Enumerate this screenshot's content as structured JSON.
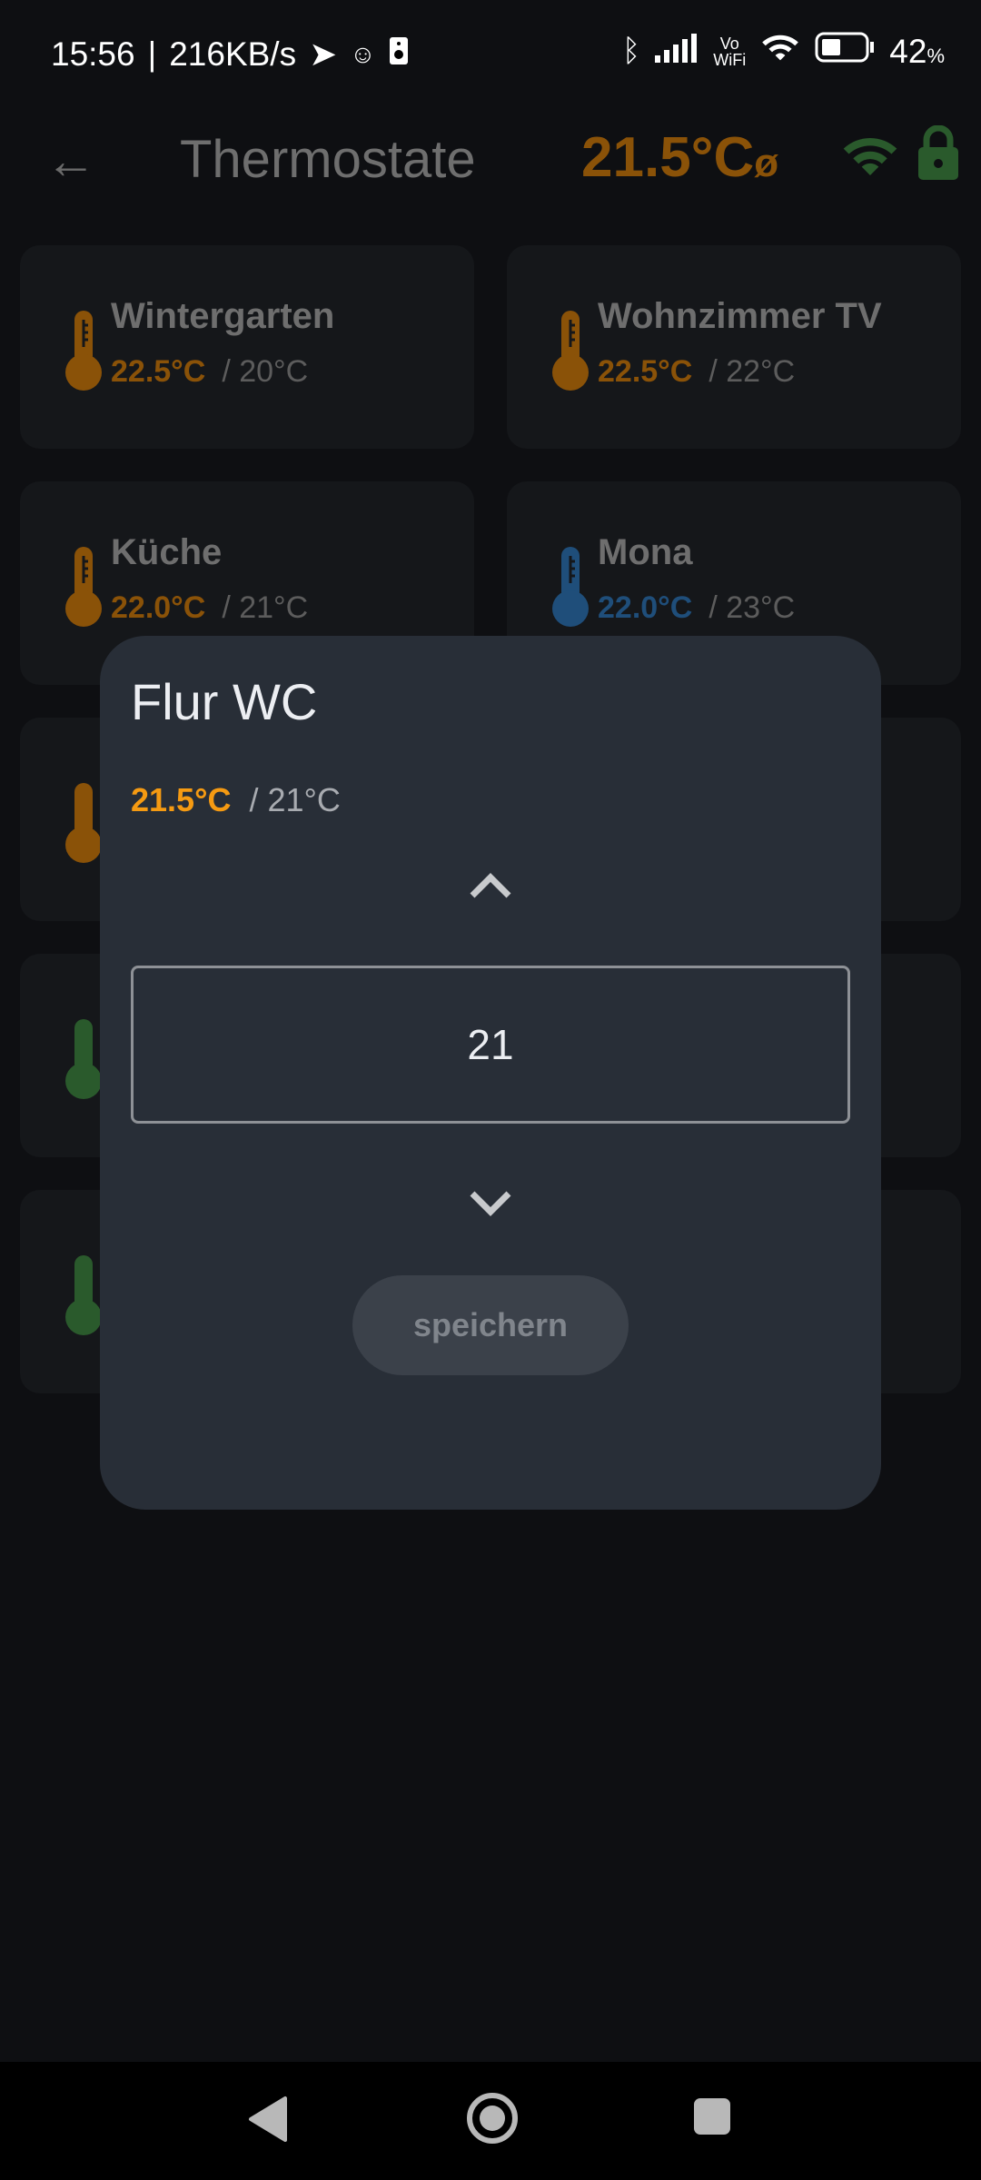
{
  "status_bar": {
    "time": "15:56",
    "speed": "216KB/s",
    "separator": "|",
    "battery": "42",
    "battery_unit": "%",
    "vowifi_top": "Vo",
    "vowifi_bottom": "WiFi"
  },
  "header": {
    "title": "Thermostate",
    "average": "21.5°C",
    "average_symbol": "ø"
  },
  "colors": {
    "orange_dim": "#8a5208",
    "orange": "#f59a12",
    "blue_dim": "#1f4e7a",
    "green_dim": "#2a5a2c",
    "dialog": "#282e37"
  },
  "cards": [
    {
      "name": "Wintergarten",
      "current": "22.5°C",
      "target": "/ 20°C",
      "color": "#8a5208"
    },
    {
      "name": "Wohnzimmer TV",
      "current": "22.5°C",
      "target": "/ 22°C",
      "color": "#8a5208"
    },
    {
      "name": "Küche",
      "current": "22.0°C",
      "target": "/ 21°C",
      "color": "#8a5208"
    },
    {
      "name": "Mona",
      "current": "22.0°C",
      "target": "/ 23°C",
      "color": "#1f4e7a"
    }
  ],
  "dialog": {
    "title": "Flur WC",
    "current": "21.5°C",
    "target": "/ 21°C",
    "value": "21",
    "save_label": "speichern"
  }
}
